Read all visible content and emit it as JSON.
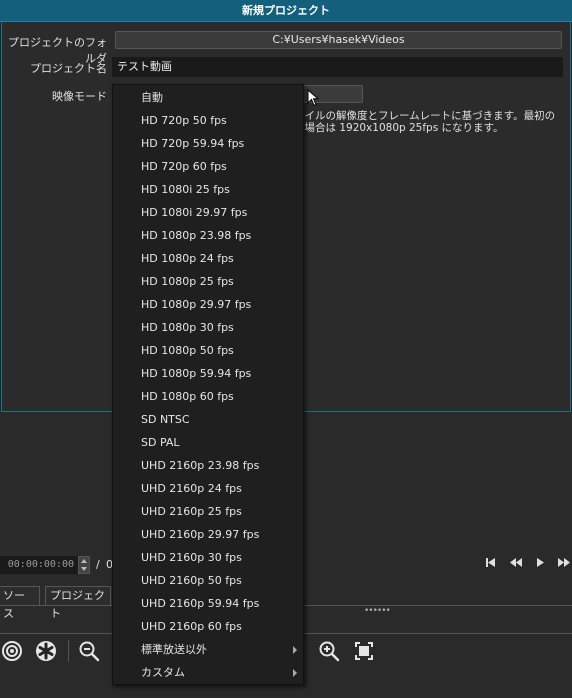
{
  "window": {
    "title": "新規プロジェクト"
  },
  "form": {
    "folder_label": "プロジェクトのフォルダ",
    "folder_value": "C:¥Users¥hasek¥Videos",
    "name_label": "プロジェクト名",
    "name_value": "テスト動画",
    "mode_label": "映像モード",
    "description_line1": "ァイルの解像度とフレームレートに基づきます。最初の",
    "description_line2": "の場合は 1920x1080p 25fps になります。"
  },
  "menu": {
    "items": [
      "自動",
      "HD 720p 50 fps",
      "HD 720p 59.94 fps",
      "HD 720p 60 fps",
      "HD 1080i 25 fps",
      "HD 1080i 29.97 fps",
      "HD 1080p 23.98 fps",
      "HD 1080p 24 fps",
      "HD 1080p 25 fps",
      "HD 1080p 29.97 fps",
      "HD 1080p 30 fps",
      "HD 1080p 50 fps",
      "HD 1080p 59.94 fps",
      "HD 1080p 60 fps",
      "SD NTSC",
      "SD PAL",
      "UHD 2160p 23.98 fps",
      "UHD 2160p 24 fps",
      "UHD 2160p 25 fps",
      "UHD 2160p 29.97 fps",
      "UHD 2160p 30 fps",
      "UHD 2160p 50 fps",
      "UHD 2160p 59.94 fps",
      "UHD 2160p 60 fps"
    ],
    "submenus": [
      "標準放送以外",
      "カスタム"
    ]
  },
  "player": {
    "timecode": "00:00:00:00",
    "separator": "/",
    "duration_fragment": "0"
  },
  "tabs": {
    "source": "ソース",
    "project": "プロジェクト"
  },
  "icons": {
    "goto_start": "skip-start-icon",
    "rewind": "rewind-icon",
    "play": "play-icon",
    "fast_forward": "fast-forward-icon"
  },
  "colors": {
    "titlebar": "#135f7c",
    "accent_border": "#1b6f8f",
    "menu_bg": "#1f1f1f"
  }
}
